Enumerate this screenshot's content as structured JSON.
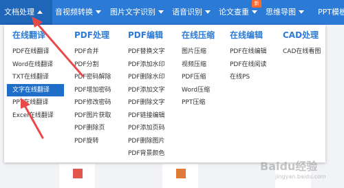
{
  "nav": {
    "items": [
      {
        "label": "文档处理",
        "active": true,
        "arrow": "up"
      },
      {
        "label": "音视频转换",
        "arrow": "down"
      },
      {
        "label": "图片文字识别",
        "arrow": "down"
      },
      {
        "label": "语音识别",
        "arrow": "down"
      },
      {
        "label": "论文查重",
        "arrow": "down"
      },
      {
        "label": "思维导图",
        "arrow": "down"
      },
      {
        "label": "PPT模板"
      }
    ],
    "badge": "新"
  },
  "dropdown": {
    "columns": [
      {
        "title": "在线翻译",
        "items": [
          "PDF在线翻译",
          "Word在线翻译",
          "TXT在线翻译",
          "文字在线翻译",
          "PPT在线翻译",
          "Excel在线翻译"
        ],
        "selected": 3
      },
      {
        "title": "PDF处理",
        "items": [
          "PDF合并",
          "PDF分割",
          "PDF密码解除",
          "PDF增加密码",
          "PDF修改密码",
          "PDF图片获取",
          "PDF删除页",
          "PDF旋转"
        ]
      },
      {
        "title": "PDF编辑",
        "items": [
          "PDF替换文字",
          "PDF添加水印",
          "PDF删除水印",
          "PDF添加文字",
          "PDF删除文字",
          "PDF链接编辑",
          "PDF添加页码",
          "PDF删除图片",
          "PDF背景颜色"
        ]
      },
      {
        "title": "在线压缩",
        "items": [
          "图片压缩",
          "视频压缩",
          "PDF压缩",
          "Word压缩",
          "PPT压缩"
        ]
      },
      {
        "title": "在线编辑",
        "items": [
          "PDF在线编辑",
          "PDF在线阅读",
          "在线PS"
        ]
      },
      {
        "title": "CAD处理",
        "items": [
          "CAD在线看图"
        ]
      }
    ]
  },
  "watermark": {
    "text": "Baidu经验",
    "sub": "jingyan.baidu.com"
  },
  "colors": {
    "nav": "#2b7bd6",
    "accent": "#2b7bd6",
    "selected": "#1f6fc9",
    "arrow": "#e84a4a",
    "badge": "#ff6a2a"
  }
}
